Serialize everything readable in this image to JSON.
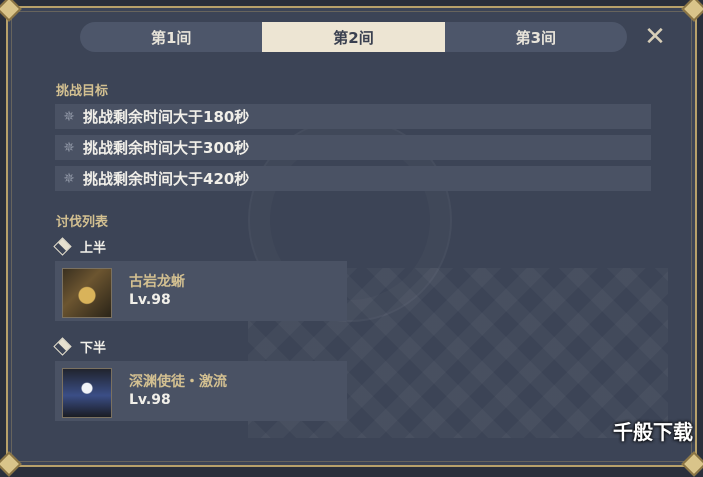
{
  "tabs": [
    {
      "label": "第1间",
      "active": false
    },
    {
      "label": "第2间",
      "active": true
    },
    {
      "label": "第3间",
      "active": false
    }
  ],
  "close_icon": "close-icon",
  "goals": {
    "title": "挑战目标",
    "items": [
      "挑战剩余时间大于180秒",
      "挑战剩余时间大于300秒",
      "挑战剩余时间大于420秒"
    ]
  },
  "enemies": {
    "title": "讨伐列表",
    "first_half": {
      "label": "上半",
      "name": "古岩龙蜥",
      "level": "Lv.98"
    },
    "second_half": {
      "label": "下半",
      "name": "深渊使徒・激流",
      "level": "Lv.98"
    }
  },
  "watermark": "千般下载",
  "colors": {
    "panel": "#3c4456",
    "gold": "#d3c091",
    "active_tab": "#ede5d3"
  }
}
